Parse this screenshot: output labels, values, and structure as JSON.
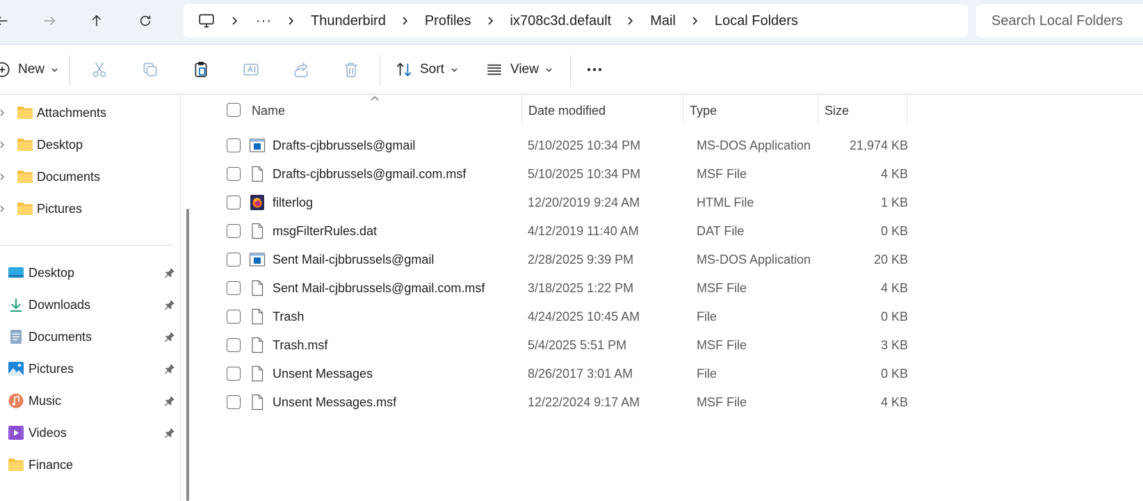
{
  "breadcrumb": {
    "overflow": "···",
    "items": [
      "Thunderbird",
      "Profiles",
      "ix708c3d.default",
      "Mail",
      "Local Folders"
    ]
  },
  "search": {
    "placeholder": "Search Local Folders"
  },
  "toolbar": {
    "new_label": "New",
    "sort_label": "Sort",
    "view_label": "View"
  },
  "sidebar": {
    "folders": [
      {
        "label": "Attachments",
        "icon": "folder-icon"
      },
      {
        "label": "Desktop",
        "icon": "folder-icon"
      },
      {
        "label": "Documents",
        "icon": "folder-icon"
      },
      {
        "label": "Pictures",
        "icon": "folder-icon"
      }
    ],
    "quick_access": [
      {
        "label": "Desktop",
        "icon": "desktop-icon",
        "pinned": true
      },
      {
        "label": "Downloads",
        "icon": "download-icon",
        "pinned": true
      },
      {
        "label": "Documents",
        "icon": "documents-icon",
        "pinned": true
      },
      {
        "label": "Pictures",
        "icon": "pictures-icon",
        "pinned": true
      },
      {
        "label": "Music",
        "icon": "music-icon",
        "pinned": true
      },
      {
        "label": "Videos",
        "icon": "videos-icon",
        "pinned": true
      },
      {
        "label": "Finance",
        "icon": "folder-icon",
        "pinned": false
      }
    ]
  },
  "columns": {
    "name": "Name",
    "date": "Date modified",
    "type": "Type",
    "size": "Size"
  },
  "files": [
    {
      "name": "Drafts-cjbbrussels@gmail",
      "date": "5/10/2025 10:34 PM",
      "type": "MS-DOS Application",
      "size": "21,974 KB",
      "icon": "app-icon"
    },
    {
      "name": "Drafts-cjbbrussels@gmail.com.msf",
      "date": "5/10/2025 10:34 PM",
      "type": "MSF File",
      "size": "4 KB",
      "icon": "file-icon"
    },
    {
      "name": "filterlog",
      "date": "12/20/2019 9:24 AM",
      "type": "HTML File",
      "size": "1 KB",
      "icon": "firefox-icon"
    },
    {
      "name": "msgFilterRules.dat",
      "date": "4/12/2019 11:40 AM",
      "type": "DAT File",
      "size": "0 KB",
      "icon": "file-icon"
    },
    {
      "name": "Sent Mail-cjbbrussels@gmail",
      "date": "2/28/2025 9:39 PM",
      "type": "MS-DOS Application",
      "size": "20 KB",
      "icon": "app-icon"
    },
    {
      "name": "Sent Mail-cjbbrussels@gmail.com.msf",
      "date": "3/18/2025 1:22 PM",
      "type": "MSF File",
      "size": "4 KB",
      "icon": "file-icon"
    },
    {
      "name": "Trash",
      "date": "4/24/2025 10:45 AM",
      "type": "File",
      "size": "0 KB",
      "icon": "file-icon"
    },
    {
      "name": "Trash.msf",
      "date": "5/4/2025 5:51 PM",
      "type": "MSF File",
      "size": "3 KB",
      "icon": "file-icon"
    },
    {
      "name": "Unsent Messages",
      "date": "8/26/2017 3:01 AM",
      "type": "File",
      "size": "0 KB",
      "icon": "file-icon"
    },
    {
      "name": "Unsent Messages.msf",
      "date": "12/22/2024 9:17 AM",
      "type": "MSF File",
      "size": "4 KB",
      "icon": "file-icon"
    }
  ],
  "colors": {
    "accent": "#0067c0",
    "folder": "#f5c242",
    "chrome_bg": "#eef3fa"
  }
}
